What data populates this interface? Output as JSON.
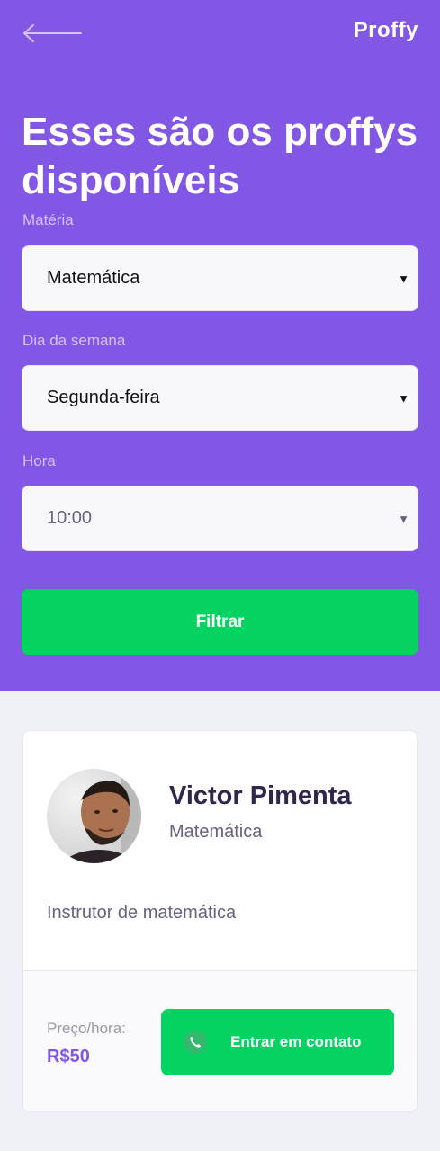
{
  "header": {
    "logo": "Proffy",
    "title": "Esses são os proffys disponíveis"
  },
  "filters": {
    "subject": {
      "label": "Matéria",
      "value": "Matemática"
    },
    "weekday": {
      "label": "Dia da semana",
      "value": "Segunda-feira"
    },
    "time": {
      "label": "Hora",
      "value": "10:00"
    },
    "submit_label": "Filtrar"
  },
  "teachers": [
    {
      "name": "Victor Pimenta",
      "subject": "Matemática",
      "bio": "Instrutor de matemática",
      "price_label": "Preço/hora:",
      "price": "R$50",
      "contact_label": "Entrar em contato"
    }
  ],
  "colors": {
    "primary": "#8257E5",
    "secondary": "#04D361",
    "background": "#F0F0F7",
    "title_in_primary": "#FFFFFF",
    "text_title": "#32264D",
    "text_base": "#6A6180"
  },
  "icons": {
    "back": "arrow-left-icon",
    "contact": "whatsapp-icon",
    "select_caret": "chevron-down-icon"
  }
}
